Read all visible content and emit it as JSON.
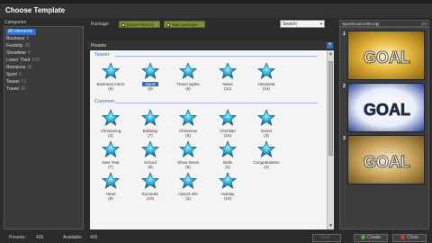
{
  "window": {
    "caption": "...",
    "title": "Choose Template"
  },
  "categories": {
    "label": "Categories",
    "items": [
      {
        "name": "All elements",
        "count": ""
      },
      {
        "name": "Business",
        "count": "8"
      },
      {
        "name": "Festivity",
        "count": "28"
      },
      {
        "name": "Showtime",
        "count": "6"
      },
      {
        "name": "Lower Third",
        "count": "103"
      },
      {
        "name": "Romance",
        "count": "35"
      },
      {
        "name": "Sport",
        "count": "6"
      },
      {
        "name": "Teaser",
        "count": "51"
      },
      {
        "name": "Travel",
        "count": "30"
      }
    ]
  },
  "toolbar": {
    "package_label": "Package:",
    "packages": [
      "Bonus Pack #1",
      "Main package"
    ],
    "search_placeholder": "Search"
  },
  "presets": {
    "label": "Presets",
    "plus": "+",
    "sections": [
      {
        "title": "Teaser",
        "items": [
          {
            "name": "Business Intros",
            "count": "(6)"
          },
          {
            "name": "Sport",
            "count": "(6)",
            "selected": true
          },
          {
            "name": "Travel sights",
            "count": "(6)"
          },
          {
            "name": "News",
            "count": "(21)"
          },
          {
            "name": "Universal",
            "count": "(24)"
          }
        ]
      },
      {
        "title": "Common",
        "items": [
          {
            "name": "Christening",
            "count": "(3)"
          },
          {
            "name": "Birthday",
            "count": "(7)"
          },
          {
            "name": "Christmas",
            "count": "(6)"
          },
          {
            "name": "Christian",
            "count": "(10)"
          },
          {
            "name": "Event",
            "count": "(3)"
          },
          {
            "name": "New Year",
            "count": "(7)"
          },
          {
            "name": "School",
            "count": "(8)"
          },
          {
            "name": "Show Intros",
            "count": "(6)"
          },
          {
            "name": "Bells",
            "count": "(2)"
          },
          {
            "name": "Congratulation",
            "count": "(4)"
          },
          {
            "name": "Heart",
            "count": "(8)"
          },
          {
            "name": "Romantic",
            "count": "(10)"
          },
          {
            "name": "Airport Info",
            "count": "(2)"
          },
          {
            "name": "Holiday",
            "count": "(10)"
          }
        ]
      }
    ]
  },
  "preview": {
    "filename": "Sport\\Goal-c000.mpj",
    "counter": "1/3",
    "items": [
      {
        "num": "1",
        "text": "GOAL"
      },
      {
        "num": "2",
        "text": "GOAL"
      },
      {
        "num": "3",
        "text": "GOAL"
      }
    ]
  },
  "status": {
    "presets_label": "Presets:",
    "presets_value": "426",
    "available_label": "Available:",
    "available_value": "426"
  },
  "buttons": {
    "next": "Next",
    "create": "Create",
    "close": "Close"
  },
  "colors": {
    "accent": "#2f6fcf",
    "star": "#29b6e8",
    "package": "#7b8f3a"
  }
}
